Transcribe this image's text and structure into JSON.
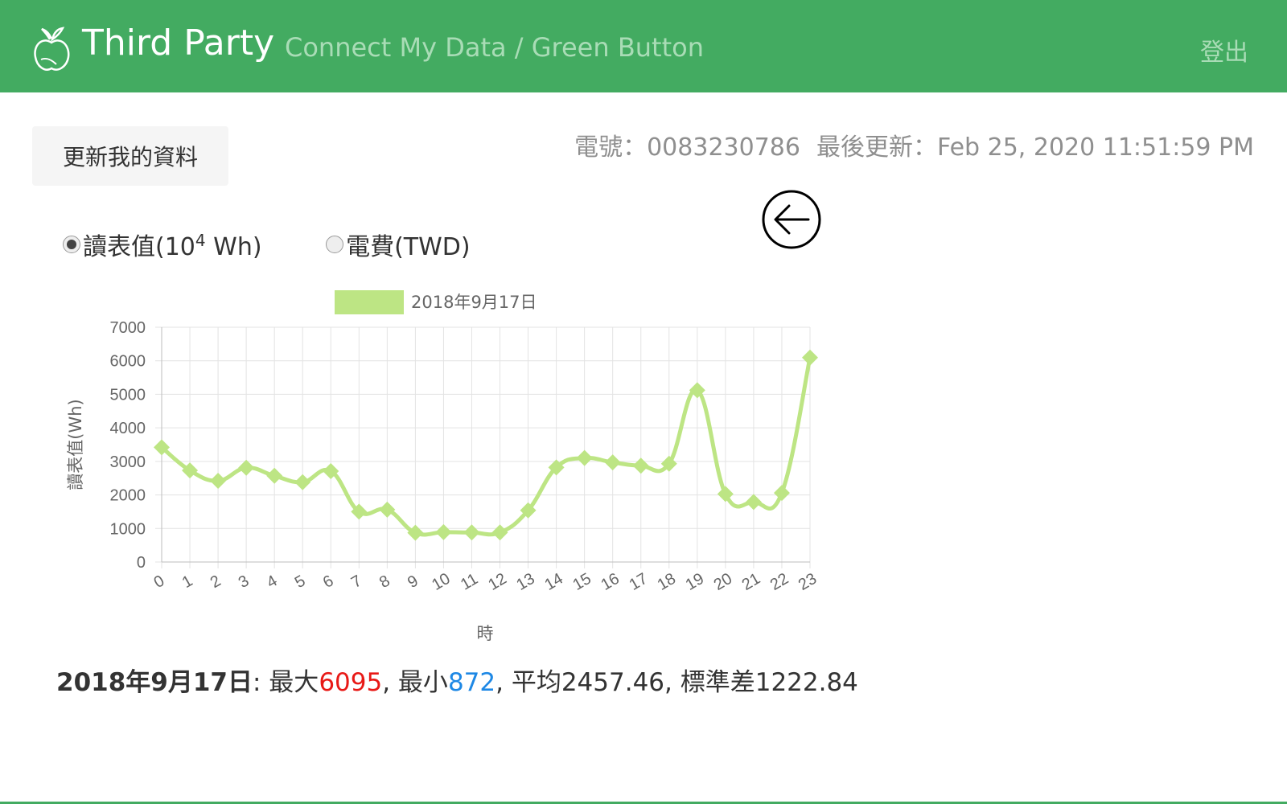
{
  "app": {
    "brand": "Third Party",
    "subtitle": "Connect My Data / Green Button",
    "logout": "登出"
  },
  "toolbar": {
    "update_label": "更新我的資料",
    "account_text": "電號：0083230786",
    "updated_text": "最後更新：Feb 25, 2020 11:51:59 PM"
  },
  "radios": {
    "reading_label": "讀表值(10",
    "reading_sup": "4",
    "reading_unit": " Wh)",
    "cost_label": "電費(TWD)"
  },
  "colors": {
    "brand_green": "#43ab61",
    "series": "#bde584",
    "max": "#e81916",
    "min": "#1e88e5"
  },
  "icons": {
    "logo": "apple-leaf-icon",
    "back": "back-arrow-circle-icon"
  },
  "chart_data": {
    "type": "line",
    "x": [
      "0",
      "1",
      "2",
      "3",
      "4",
      "5",
      "6",
      "7",
      "8",
      "9",
      "10",
      "11",
      "12",
      "13",
      "14",
      "15",
      "16",
      "17",
      "18",
      "19",
      "20",
      "21",
      "22",
      "23"
    ],
    "series": [
      {
        "name": "2018年9月17日",
        "values": [
          3420,
          2730,
          2420,
          2810,
          2570,
          2380,
          2710,
          1500,
          1560,
          872,
          890,
          880,
          880,
          1540,
          2820,
          3100,
          2970,
          2870,
          2930,
          5120,
          2030,
          1790,
          2060,
          6095
        ]
      }
    ],
    "xlabel": "時",
    "ylabel": "讀表值(Wh)",
    "ylim": [
      0,
      7000
    ],
    "yticks": [
      0,
      1000,
      2000,
      3000,
      4000,
      5000,
      6000,
      7000
    ],
    "legend": "top",
    "grid": true
  },
  "stats": {
    "date": "2018年9月17日",
    "max_label": ": 最大",
    "max": "6095",
    "min_label": ", 最小",
    "min": "872",
    "rest": ", 平均2457.46, 標準差1222.84"
  }
}
